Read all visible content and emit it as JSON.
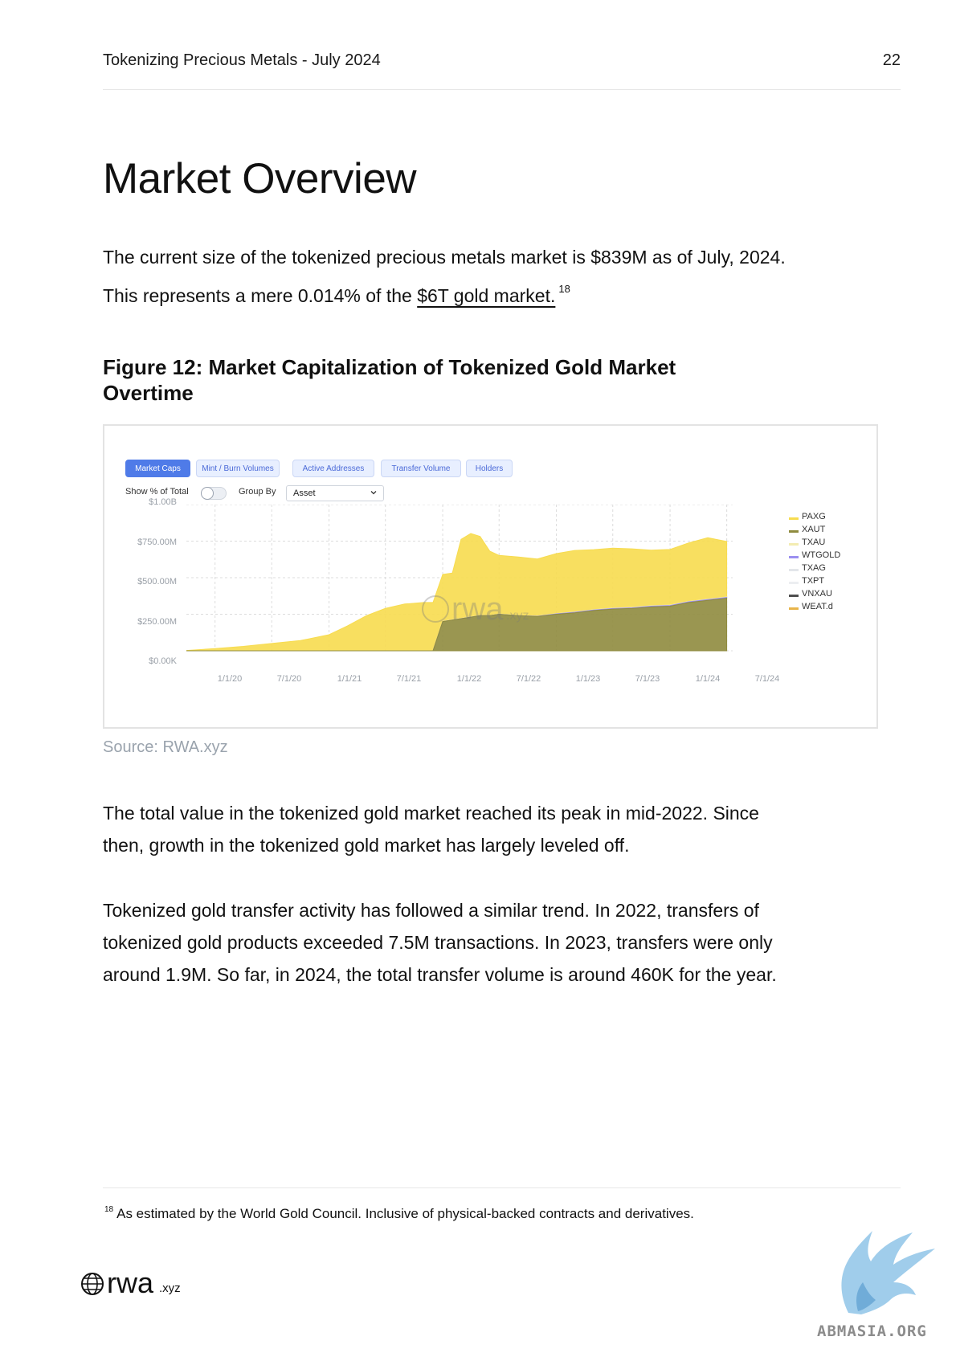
{
  "header": {
    "title": "Tokenizing Precious Metals - July 2024",
    "page_number": "22"
  },
  "section_title": "Market Overview",
  "intro": {
    "before": "The current size of the tokenized precious metals market is $839M as of July, 2024. This represents a mere 0.014% of the ",
    "link": "$6T gold market.",
    "footnote_ref": "18"
  },
  "figure": {
    "title": "Figure 12: Market Capitalization of Tokenized Gold Market Overtime",
    "tabs": [
      "Market Caps",
      "Mint / Burn Volumes",
      "Active Addresses",
      "Transfer Volume",
      "Holders"
    ],
    "active_tab": "Market Caps",
    "controls": {
      "show_pct_label": "Show % of Total",
      "group_by_label": "Group By",
      "group_by_value": "Asset"
    },
    "watermark": {
      "main": "rwa",
      "sub": ".xyz"
    },
    "source": "Source: RWA.xyz"
  },
  "chart_data": {
    "type": "area",
    "stacked": true,
    "x": [
      "2019-10-01",
      "2020-01-01",
      "2020-04-01",
      "2020-07-01",
      "2020-10-01",
      "2021-01-01",
      "2021-03-01",
      "2021-05-01",
      "2021-07-01",
      "2021-09-01",
      "2021-11-01",
      "2021-12-01",
      "2022-01-01",
      "2022-02-01",
      "2022-03-01",
      "2022-04-01",
      "2022-05-01",
      "2022-06-01",
      "2022-07-01",
      "2022-09-01",
      "2022-11-01",
      "2023-01-01",
      "2023-03-01",
      "2023-05-01",
      "2023-07-01",
      "2023-09-01",
      "2023-11-01",
      "2024-01-01",
      "2024-03-01",
      "2024-05-01",
      "2024-07-01"
    ],
    "series": [
      {
        "name": "PAXG",
        "color": "#f7dc4f",
        "values": [
          2,
          15,
          30,
          50,
          70,
          110,
          170,
          240,
          290,
          320,
          330,
          330,
          320,
          320,
          540,
          570,
          540,
          440,
          400,
          400,
          390,
          410,
          420,
          410,
          410,
          400,
          380,
          380,
          400,
          420,
          380
        ]
      },
      {
        "name": "XAUT",
        "color": "#8f8b3e",
        "values": [
          0,
          0,
          0,
          0,
          0,
          0,
          0,
          0,
          0,
          0,
          0,
          0,
          200,
          210,
          220,
          230,
          240,
          240,
          250,
          240,
          235,
          250,
          260,
          275,
          285,
          290,
          300,
          305,
          330,
          345,
          360
        ]
      },
      {
        "name": "TXAU",
        "color": "#f3ecb1",
        "values": [
          0,
          0,
          0,
          0,
          0,
          0,
          0,
          0,
          0,
          0,
          0,
          0,
          2,
          2,
          2,
          2,
          2,
          2,
          2,
          2,
          2,
          2,
          2,
          3,
          3,
          3,
          3,
          3,
          3,
          3,
          3
        ]
      },
      {
        "name": "WTGOLD",
        "color": "#9b8ff0",
        "values": [
          0,
          0,
          0,
          0,
          0,
          0,
          0,
          0,
          0,
          0,
          0,
          0,
          0,
          0,
          0,
          0,
          0,
          0,
          0,
          0,
          1,
          3,
          4,
          4,
          4,
          4,
          5,
          5,
          5,
          5,
          5
        ]
      },
      {
        "name": "TXAG",
        "color": "#e3e6ea",
        "values": [
          0,
          0,
          0,
          0,
          0,
          0,
          0,
          0,
          0,
          0,
          0,
          0,
          0,
          0,
          0,
          0,
          0,
          0,
          0,
          0,
          0,
          0,
          0,
          0,
          0,
          0,
          0,
          0,
          0,
          0,
          0
        ]
      },
      {
        "name": "TXPT",
        "color": "#eceef1",
        "values": [
          0,
          0,
          0,
          0,
          0,
          0,
          0,
          0,
          0,
          0,
          0,
          0,
          0,
          0,
          0,
          0,
          0,
          0,
          0,
          0,
          0,
          0,
          0,
          0,
          0,
          0,
          0,
          0,
          0,
          0,
          0
        ]
      },
      {
        "name": "VNXAU",
        "color": "#4f4f4f",
        "values": [
          0,
          0,
          0,
          0,
          0,
          0,
          0,
          0,
          0,
          0,
          0,
          0,
          0,
          0,
          0,
          0,
          0,
          0,
          0,
          0,
          0,
          0,
          0,
          0,
          0,
          0,
          0,
          0,
          0,
          0,
          0
        ]
      },
      {
        "name": "WEAT.d",
        "color": "#e8b54a",
        "values": [
          0,
          0,
          0,
          0,
          0,
          0,
          0,
          0,
          0,
          0,
          0,
          0,
          0,
          0,
          0,
          0,
          0,
          0,
          0,
          0,
          0,
          0,
          0,
          0,
          0,
          0,
          0,
          0,
          0,
          0,
          0
        ]
      }
    ],
    "y_ticks": [
      "$1.00B",
      "$750.00M",
      "$500.00M",
      "$250.00M",
      "$0.00K"
    ],
    "x_ticks": [
      "1/1/20",
      "7/1/20",
      "1/1/21",
      "7/1/21",
      "1/1/22",
      "7/1/22",
      "1/1/23",
      "7/1/23",
      "1/1/24",
      "7/1/24"
    ],
    "ylim": [
      0,
      1000
    ],
    "y_unit": "$M",
    "grid": true,
    "legend_position": "right"
  },
  "after_figure": {
    "p1": "The total value in the tokenized gold market reached its peak in mid-2022. Since then, growth in the tokenized gold market has largely leveled off.",
    "p2": "Tokenized gold transfer activity has followed a similar trend. In 2022, transfers of tokenized gold products exceeded 7.5M transactions. In 2023, transfers were only around 1.9M. So far, in 2024, the total transfer volume is around 460K for the year."
  },
  "footnote": {
    "number": "18",
    "text": "As estimated by the World Gold Council. Inclusive of physical-backed contracts and derivatives."
  },
  "footer": {
    "brand_main": "rwa",
    "brand_sub": ".xyz",
    "watermark_text": "ABMASIA.ORG"
  }
}
